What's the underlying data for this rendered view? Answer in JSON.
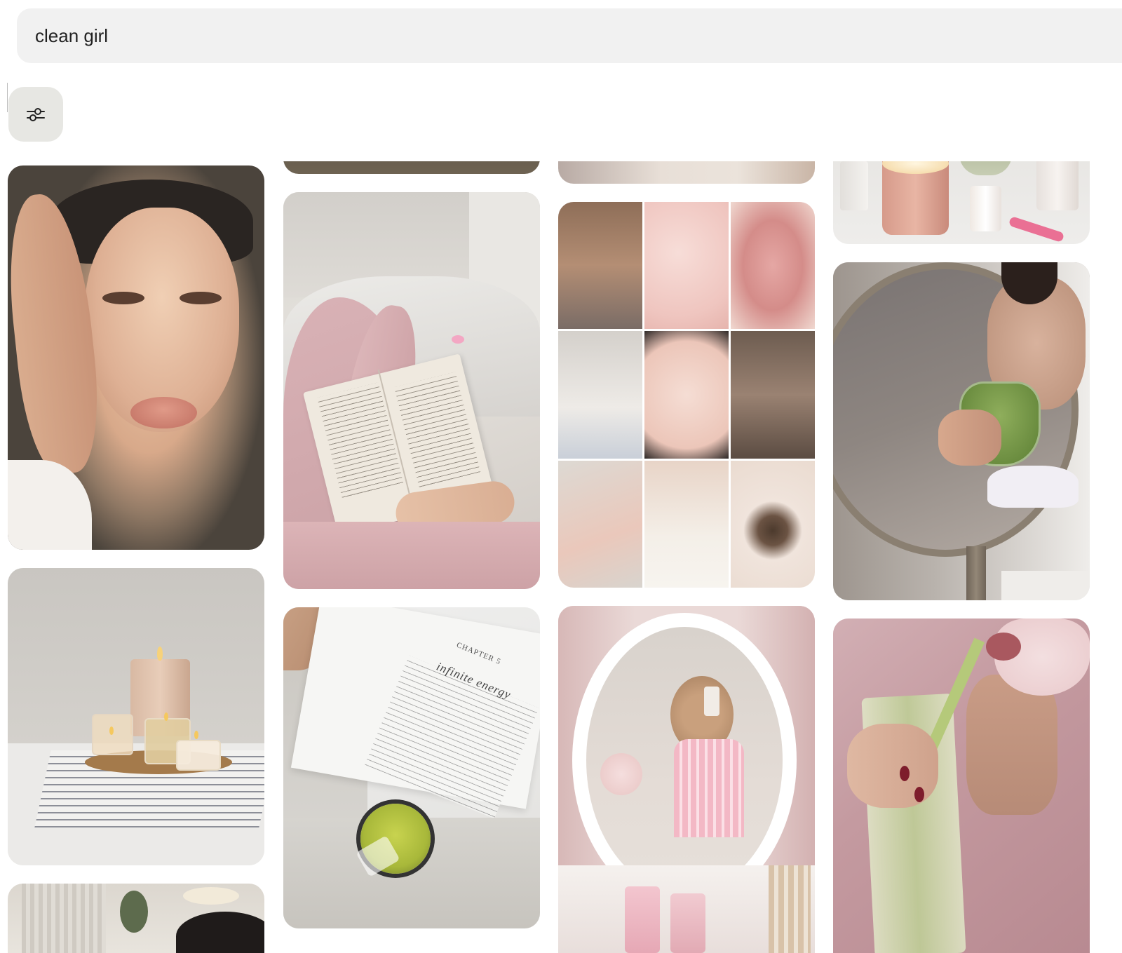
{
  "search": {
    "value": "clean girl",
    "placeholder": ""
  },
  "filter": {
    "icon": "sliders-icon"
  },
  "pins": [
    {
      "column": 1,
      "description": "Woman with glowing skin, hand on head"
    },
    {
      "column": 1,
      "description": "Lit candles on stacked magazines"
    },
    {
      "column": 1,
      "description": "Partially visible pin at bottom"
    },
    {
      "column": 2,
      "description": "Partially visible pin at top"
    },
    {
      "column": 2,
      "description": "Reading a book in bed in pink"
    },
    {
      "column": 2,
      "description": "Open book with matcha drink"
    },
    {
      "column": 3,
      "description": "Partially visible pin at top"
    },
    {
      "column": 3,
      "description": "Beauty collage grid"
    },
    {
      "column": 3,
      "description": "Mirror selfie in pink pajamas"
    },
    {
      "column": 4,
      "description": "Candles and skincare on vanity"
    },
    {
      "column": 4,
      "description": "Mirror selfie with green drink"
    },
    {
      "column": 4,
      "description": "Drinking iced matcha in robe"
    }
  ],
  "book": {
    "chapter": "CHAPTER 5",
    "title": "infinite energy"
  },
  "colors": {
    "search_bg": "#f1f1f1",
    "filter_bg": "#e7e7e3",
    "text": "#222222"
  }
}
